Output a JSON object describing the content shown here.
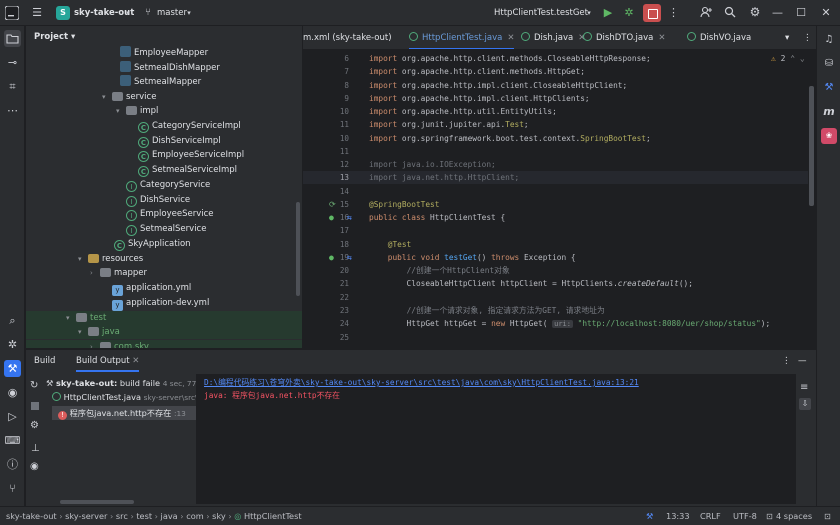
{
  "titlebar": {
    "project_badge": "S",
    "project_name": "sky-take-out",
    "branch": "master",
    "run_config": "HttpClientTest.testGet"
  },
  "project_panel": {
    "title": "Project",
    "tree": [
      {
        "label": "EmployeeMapper",
        "icon": "file"
      },
      {
        "label": "SetmealDishMapper",
        "icon": "file"
      },
      {
        "label": "SetmealMapper",
        "icon": "file"
      },
      {
        "label": "service",
        "icon": "folder"
      },
      {
        "label": "impl",
        "icon": "folder"
      },
      {
        "label": "CategoryServiceImpl",
        "icon": "class"
      },
      {
        "label": "DishServiceImpl",
        "icon": "class"
      },
      {
        "label": "EmployeeServiceImpl",
        "icon": "class"
      },
      {
        "label": "SetmealServiceImpl",
        "icon": "class"
      },
      {
        "label": "CategoryService",
        "icon": "interface"
      },
      {
        "label": "DishService",
        "icon": "interface"
      },
      {
        "label": "EmployeeService",
        "icon": "interface"
      },
      {
        "label": "SetmealService",
        "icon": "interface"
      },
      {
        "label": "SkyApplication",
        "icon": "class"
      },
      {
        "label": "resources",
        "icon": "resources"
      },
      {
        "label": "mapper",
        "icon": "folder"
      },
      {
        "label": "application.yml",
        "icon": "yml"
      },
      {
        "label": "application-dev.yml",
        "icon": "yml"
      },
      {
        "label": "test",
        "icon": "folder"
      },
      {
        "label": "java",
        "icon": "folder"
      },
      {
        "label": "com.sky",
        "icon": "folder"
      }
    ]
  },
  "editor": {
    "tabs": [
      {
        "label": "m.xml (sky-take-out)"
      },
      {
        "label": "HttpClientTest.java"
      },
      {
        "label": "Dish.java"
      },
      {
        "label": "DishDTO.java"
      },
      {
        "label": "DishVO.java"
      }
    ],
    "warnings_count": "2",
    "lines": [
      {
        "n": "6",
        "html": "<span class='kw'>import</span> org.apache.http.client.methods.CloseableHttpResponse;"
      },
      {
        "n": "7",
        "html": "<span class='kw'>import</span> org.apache.http.client.methods.HttpGet;"
      },
      {
        "n": "8",
        "html": "<span class='kw'>import</span> org.apache.http.impl.client.CloseableHttpClient;"
      },
      {
        "n": "9",
        "html": "<span class='kw'>import</span> org.apache.http.impl.client.HttpClients;"
      },
      {
        "n": "10",
        "html": "<span class='kw'>import</span> org.apache.http.util.EntityUtils;"
      },
      {
        "n": "11",
        "html": "<span class='kw'>import</span> org.junit.jupiter.api.<span class='an'>Test</span>;"
      },
      {
        "n": "10",
        "html": "<span class='kw'>import</span> org.springframework.boot.test.context.<span class='an'>SpringBootTest</span>;"
      },
      {
        "n": "11",
        "html": ""
      },
      {
        "n": "12",
        "html": "<span class='dim'>import java.io.IOException;</span>"
      },
      {
        "n": "13",
        "html": "<span class='dim'>import java.net.http.HttpClient;</span>"
      },
      {
        "n": "14",
        "html": ""
      },
      {
        "n": "15",
        "html": "<span class='an'>@SpringBootTest</span>"
      },
      {
        "n": "16",
        "html": "<span class='kw'>public class</span> HttpClientTest {"
      },
      {
        "n": "17",
        "html": ""
      },
      {
        "n": "18",
        "html": "    <span class='an'>@Test</span>"
      },
      {
        "n": "19",
        "html": "    <span class='kw'>public void</span> <span class='fn'>testGet</span>() <span class='kw'>throws</span> Exception {"
      },
      {
        "n": "20",
        "html": "        <span class='cm'>//创建一个HttpClient对象</span>"
      },
      {
        "n": "21",
        "html": "        CloseableHttpClient httpClient = HttpClients.<span class='it'>createDefault</span>();"
      },
      {
        "n": "22",
        "html": ""
      },
      {
        "n": "23",
        "html": "        <span class='cm'>//创建一个请求对象, 指定请求方法为GET, 请求地址为</span>"
      },
      {
        "n": "24",
        "html": "        HttpGet httpGet = <span class='kw'>new</span> HttpGet( <span class='hint'>uri:</span> <span class='str'>\"http://localhost:8080/uer/shop/status\"</span>);"
      },
      {
        "n": "25",
        "html": ""
      }
    ]
  },
  "build": {
    "tabs": [
      {
        "label": "Build"
      },
      {
        "label": "Build Output"
      }
    ],
    "root": {
      "label": "sky-take-out:",
      "status": "build faile",
      "time": "4 sec, 77 ms"
    },
    "file": {
      "label": "HttpClientTest.java",
      "module": "sky-server\\src\\"
    },
    "error_item": {
      "label": "程序包java.net.http不存在",
      "line": ":13"
    },
    "output_path": "D:\\编程代码练习\\苍穹外卖\\sky-take-out\\sky-server\\src\\test\\java\\com\\sky\\HttpClientTest.java:13:21",
    "output_error": "java: 程序包java.net.http不存在"
  },
  "statusbar": {
    "breadcrumb": [
      "sky-take-out",
      "sky-server",
      "src",
      "test",
      "java",
      "com",
      "sky",
      "HttpClientTest"
    ],
    "position": "13:33",
    "line_sep": "CRLF",
    "encoding": "UTF-8",
    "indent": "4 spaces"
  }
}
